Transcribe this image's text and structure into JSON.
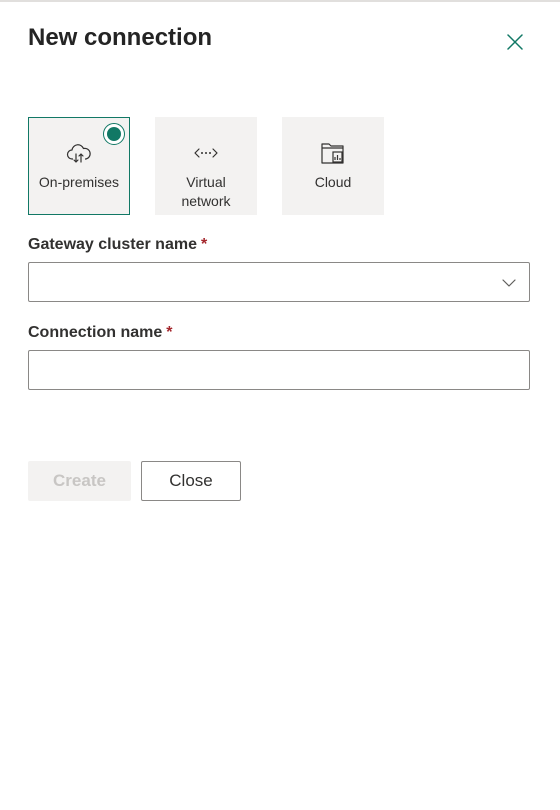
{
  "dialog": {
    "title": "New connection",
    "close_icon": "close-icon"
  },
  "connection_types": {
    "selected": "On-premises",
    "options": [
      {
        "label": "On-premises",
        "icon": "cloud-upload-icon",
        "selected": true
      },
      {
        "label": "Virtual network",
        "icon": "virtual-network-icon",
        "selected": false
      },
      {
        "label": "Cloud",
        "icon": "cloud-folder-icon",
        "selected": false
      }
    ]
  },
  "fields": {
    "gateway": {
      "label": "Gateway cluster name",
      "required_marker": "*",
      "value": ""
    },
    "connection_name": {
      "label": "Connection name",
      "required_marker": "*",
      "value": ""
    }
  },
  "buttons": {
    "create_label": "Create",
    "close_label": "Close"
  },
  "colors": {
    "accent": "#117865",
    "required": "#a4262c",
    "option_bg": "#f3f2f1",
    "disabled_text": "#c8c6c4"
  }
}
